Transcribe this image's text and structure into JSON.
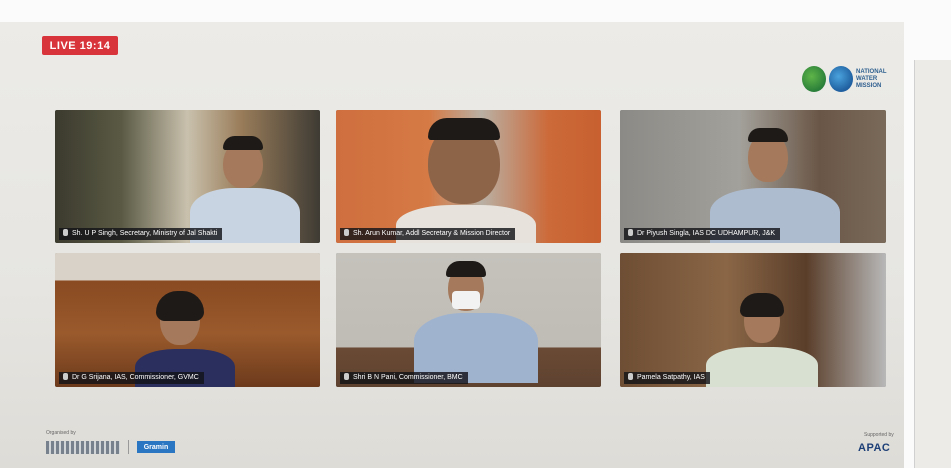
{
  "live_badge": "LIVE 19:14",
  "brand": {
    "logo_text": "NATIONAL WATER MISSION"
  },
  "participants": [
    {
      "name": "Sh. U P Singh, Secretary, Ministry of Jal Shakti"
    },
    {
      "name": "Sh. Arun Kumar, Addl Secretary & Mission Director"
    },
    {
      "name": "Dr Piyush Singla, IAS DC UDHAMPUR, J&K"
    },
    {
      "name": "Dr G Srijana, IAS, Commissioner, GVMC"
    },
    {
      "name": "Shri B N Pani, Commissioner, BMC"
    },
    {
      "name": "Pamela Satpathy, IAS"
    }
  ],
  "footer": {
    "organised_by": "Organised by",
    "partner_badge": "Gramin",
    "supported_by": "Supported by",
    "sponsor": "APAC"
  }
}
